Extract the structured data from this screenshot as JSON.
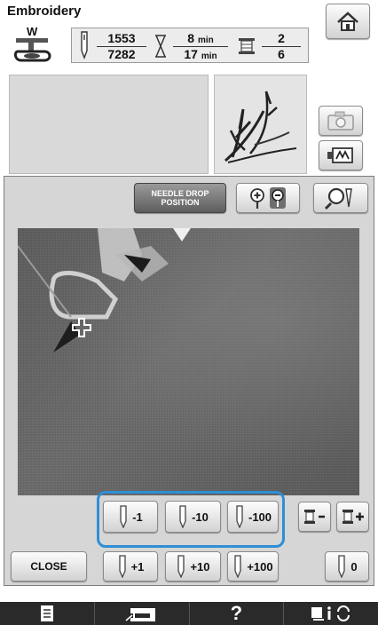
{
  "header": {
    "title": "Embroidery",
    "presser_foot": "W"
  },
  "counter": {
    "stitch_current": "1553",
    "stitch_total": "7282",
    "time_current": "8",
    "time_total": "17",
    "time_unit": "min",
    "color_current": "2",
    "color_total": "6"
  },
  "toolbar": {
    "needle_drop_line1": "NEEDLE DROP",
    "needle_drop_line2": "POSITION"
  },
  "steps": {
    "minus_1": "-1",
    "minus_10": "-10",
    "minus_100": "-100",
    "plus_1": "+1",
    "plus_10": "+10",
    "plus_100": "+100",
    "zero": "0"
  },
  "close_label": "CLOSE",
  "bottom_bar": {
    "help": "?"
  },
  "colors": {
    "highlight": "#2e8fd6",
    "bottom_bar": "#2a2a2a"
  }
}
